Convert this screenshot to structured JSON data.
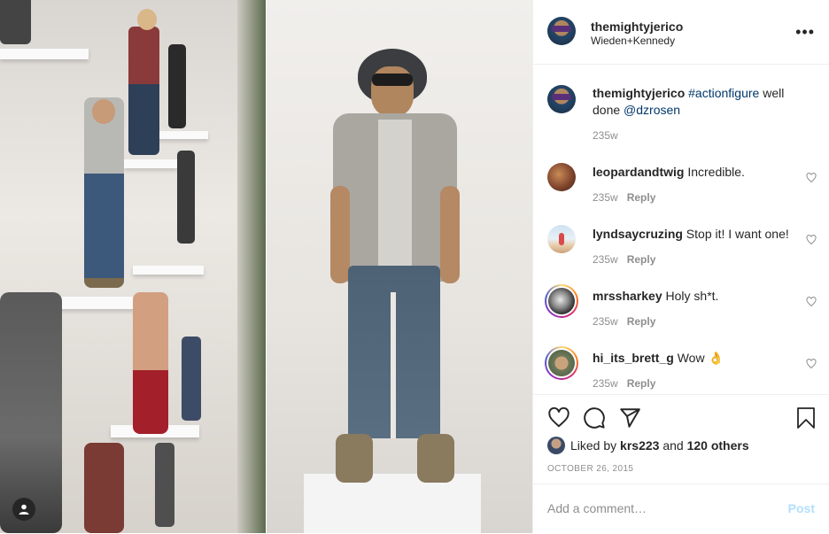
{
  "post": {
    "username": "themightyjerico",
    "location": "Wieden+Kennedy",
    "caption_user": "themightyjerico",
    "caption_tag": "#actionfigure",
    "caption_mid": " well done ",
    "caption_mention": "@dzrosen",
    "caption_time": "235w"
  },
  "comments": [
    {
      "user": "leopardandtwig",
      "text": " Incredible.",
      "time": "235w",
      "reply": "Reply"
    },
    {
      "user": "lyndsaycruzing",
      "text": " Stop it! I want one!",
      "time": "235w",
      "reply": "Reply"
    },
    {
      "user": "mrssharkey",
      "text": " Holy sh*t.",
      "time": "235w",
      "reply": "Reply"
    },
    {
      "user": "hi_its_brett_g",
      "text": " Wow 👌",
      "time": "235w",
      "reply": "Reply"
    }
  ],
  "likes": {
    "prefix": "Liked by ",
    "user": "krs223",
    "mid": " and ",
    "others": "120 others"
  },
  "date": "OCTOBER 26, 2015",
  "add_comment": {
    "placeholder": "Add a comment…",
    "post_label": "Post"
  },
  "colors": {
    "link": "#00376b",
    "muted": "#8e8e8e",
    "post_disabled": "#b2dffc",
    "story_ring": "#d6249f"
  }
}
